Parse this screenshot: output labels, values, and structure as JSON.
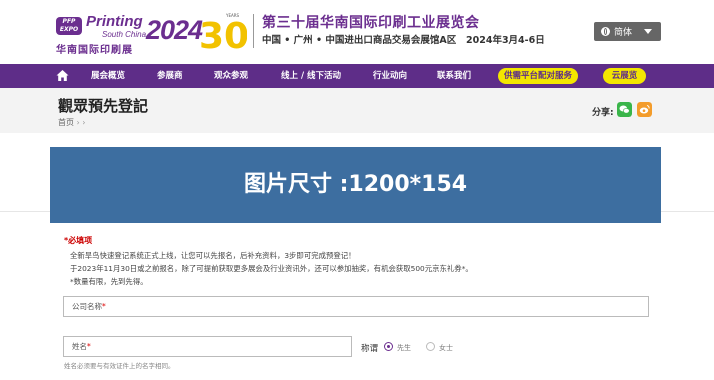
{
  "brand": {
    "badge_line1": "PFP",
    "badge_line2": "EXPO",
    "printing": "Printing",
    "south_china": "South China",
    "year": "2024",
    "name_cn": "华南国际印刷展",
    "anniversary": "30",
    "anniversary_small": "YEARS"
  },
  "header": {
    "title": "第三十届华南国际印刷工业展览会",
    "venue": "中国 • 广州 • 中国进出口商品交易会展馆A区",
    "dates": "2024年3月4-6日",
    "language": "简体"
  },
  "nav": {
    "items": [
      "展会概览",
      "参展商",
      "观众参观",
      "线上 / 线下活动",
      "行业动向",
      "联系我们"
    ],
    "pill_1": "供需平台配对服务",
    "pill_2": "云展览"
  },
  "page": {
    "title": "觀眾預先登記",
    "breadcrumb_home": "首页",
    "breadcrumb_sep": "›  ›",
    "share_label": "分享:"
  },
  "banner": {
    "text": "图片尺寸 :1200*154",
    "color": "#3d6ea0"
  },
  "form": {
    "required_label": "*必填项",
    "notes": [
      "全新旱鸟快速登记系统正式上线，让您可以先报名，后补充资料，3步即可完成预登记！",
      "于2023年11月30日或之前报名，除了可提前获取更多展会及行业资讯外，还可以参加抽奖，有机会获取500元京东礼券*。",
      "*数量有限，先到先得。"
    ],
    "company_label": "公司名称",
    "name_label": "姓名",
    "required_mark": "*",
    "gender_label": "称谓",
    "gender_options": [
      "先生",
      "女士"
    ],
    "gender_selected": "先生",
    "name_hint": "姓名必须要与有效证件上的名字相同。"
  },
  "colors": {
    "brand_purple": "#5e2d88",
    "pill_yellow": "#f3e600",
    "wechat_green": "#3ab54a",
    "weibo_orange": "#f39c2b"
  }
}
